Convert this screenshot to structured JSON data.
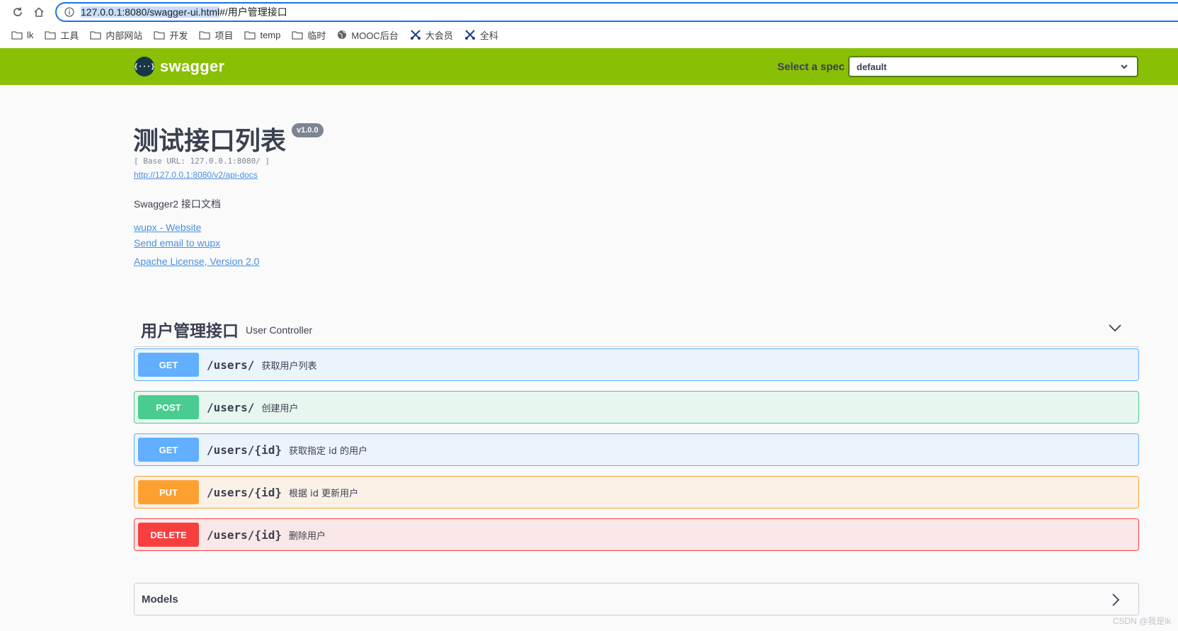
{
  "browser": {
    "url_selected": "127.0.0.1:8080/swagger-ui.html",
    "url_rest": "#/用户管理接口",
    "bookmarks": [
      {
        "label": "lk",
        "icon": "folder-icon"
      },
      {
        "label": "工具",
        "icon": "folder-icon"
      },
      {
        "label": "内部网站",
        "icon": "folder-icon"
      },
      {
        "label": "开发",
        "icon": "folder-icon"
      },
      {
        "label": "项目",
        "icon": "folder-icon"
      },
      {
        "label": "temp",
        "icon": "folder-icon"
      },
      {
        "label": "临时",
        "icon": "folder-icon"
      },
      {
        "label": "MOOC后台",
        "icon": "globe-icon"
      },
      {
        "label": "大会员",
        "icon": "tool-icon"
      },
      {
        "label": "全科",
        "icon": "tool-icon"
      }
    ]
  },
  "topbar": {
    "logo_text": "swagger",
    "logo_glyph": "{···}",
    "spec_label": "Select a spec",
    "spec_value": "default",
    "bg_color": "#89bf04"
  },
  "info": {
    "title": "测试接口列表",
    "version": "v1.0.0",
    "base_url": "[ Base URL: 127.0.0.1:8080/ ]",
    "docs_link": "http://127.0.0.1:8080/v2/api-docs",
    "description": "Swagger2 接口文档",
    "website_link": "wupx - Website",
    "email_link": "Send email to wupx",
    "license_link": "Apache License, Version 2.0"
  },
  "tag": {
    "name": "用户管理接口",
    "description": "User Controller"
  },
  "operations": [
    {
      "method": "GET",
      "path": "/users/",
      "summary": "获取用户列表",
      "color": "#61affe"
    },
    {
      "method": "POST",
      "path": "/users/",
      "summary": "创建用户",
      "color": "#49cc90"
    },
    {
      "method": "GET",
      "path": "/users/{id}",
      "summary": "获取指定 id 的用户",
      "color": "#61affe"
    },
    {
      "method": "PUT",
      "path": "/users/{id}",
      "summary": "根据 id 更新用户",
      "color": "#fca130"
    },
    {
      "method": "DELETE",
      "path": "/users/{id}",
      "summary": "删除用户",
      "color": "#f93e3e"
    }
  ],
  "models": {
    "title": "Models"
  },
  "watermark": "CSDN @我是lk"
}
